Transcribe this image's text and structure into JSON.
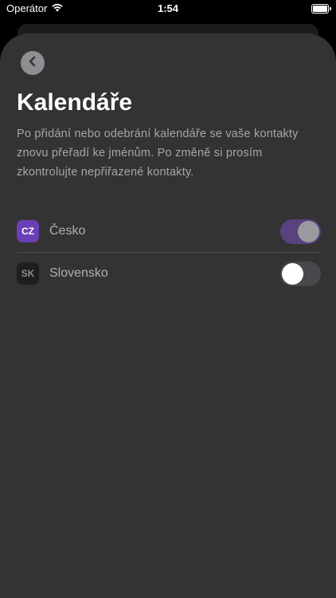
{
  "status_bar": {
    "carrier": "Operátor",
    "time": "1:54"
  },
  "page": {
    "title": "Kalendáře",
    "description": "Po přidání nebo odebrání kalendáře se vaše kontakty znovu přeřadí ke jménům. Po změně si prosím zkontrolujte nepřiřazené kontakty."
  },
  "calendars": [
    {
      "code": "CZ",
      "label": "Česko",
      "enabled": true
    },
    {
      "code": "SK",
      "label": "Slovensko",
      "enabled": false
    }
  ],
  "colors": {
    "sheet_background": "#333333",
    "accent_badge": "#6b3fb5",
    "toggle_on": "#5a4180"
  },
  "icons": {
    "back": "chevron-left-icon",
    "wifi": "wifi-icon",
    "battery": "battery-icon"
  }
}
